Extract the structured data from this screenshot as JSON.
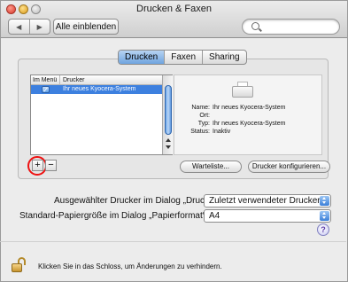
{
  "window": {
    "title": "Drucken & Faxen"
  },
  "toolbar": {
    "back_label": "◀",
    "forward_label": "▶",
    "show_all_label": "Alle einblenden",
    "search_placeholder": ""
  },
  "tabs": [
    {
      "label": "Drucken",
      "active": true
    },
    {
      "label": "Faxen",
      "active": false
    },
    {
      "label": "Sharing",
      "active": false
    }
  ],
  "printer_list": {
    "columns": [
      "Im Menü",
      "Drucker"
    ],
    "rows": [
      {
        "in_menu": true,
        "checkmark": "✓",
        "name": "Ihr neues Kyocera-System",
        "selected": true
      }
    ]
  },
  "printer_info": {
    "rows": [
      {
        "label": "Name:",
        "value": "Ihr neues Kyocera-System"
      },
      {
        "label": "Ort:",
        "value": ""
      },
      {
        "label": "Typ:",
        "value": "Ihr neues Kyocera-System"
      },
      {
        "label": "Status:",
        "value": "Inaktiv"
      }
    ]
  },
  "list_controls": {
    "add_label": "+",
    "remove_label": "−"
  },
  "buttons": {
    "queue_label": "Warteliste...",
    "configure_label": "Drucker konfigurieren..."
  },
  "settings": {
    "dialog_printer_label": "Ausgewählter Drucker im Dialog „Drucken“:",
    "dialog_printer_value": "Zuletzt verwendeter Drucker",
    "paper_size_label": "Standard-Papiergröße im Dialog „Papierformat“:",
    "paper_size_value": "A4"
  },
  "help_label": "?",
  "lock_text": "Klicken Sie in das Schloss, um Änderungen zu verhindern.",
  "colors": {
    "selection": "#3d80df",
    "highlight_circle": "#e11111",
    "tab_active": "#6fa4df"
  },
  "icons": [
    "search-icon",
    "printer-icon",
    "lock-icon",
    "help-icon",
    "checkbox-icon"
  ]
}
